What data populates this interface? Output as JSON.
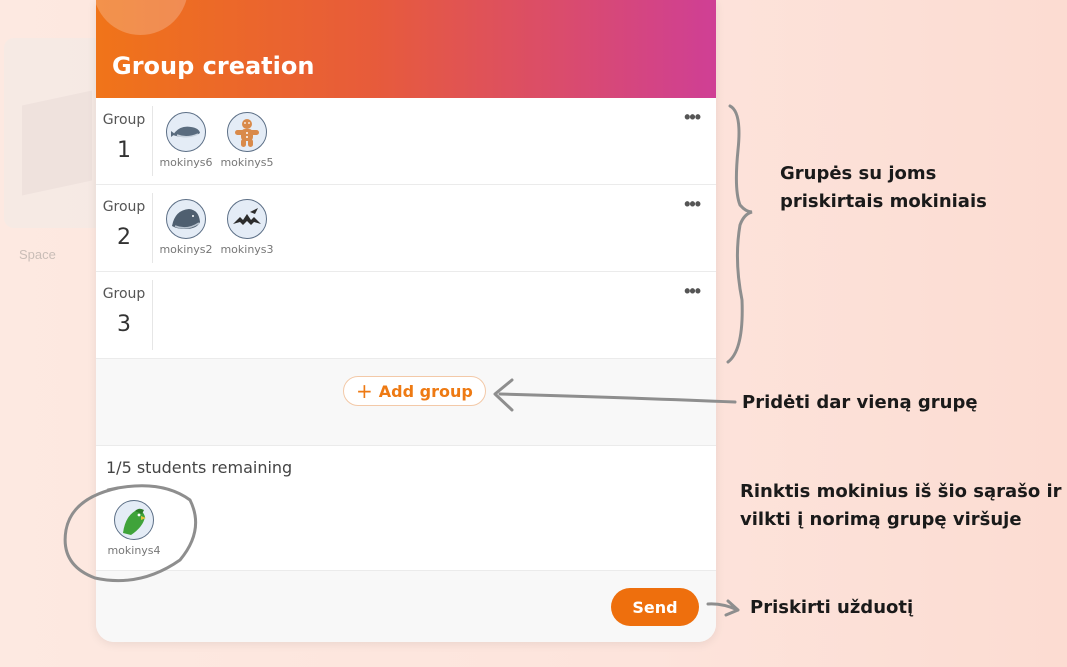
{
  "background": {
    "card_label": "Space"
  },
  "panel": {
    "title": "Group creation",
    "groups": [
      {
        "word": "Group",
        "number": "1",
        "members": [
          {
            "name": "mokinys6",
            "icon": "whale-icon"
          },
          {
            "name": "mokinys5",
            "icon": "gingerbread-icon"
          }
        ]
      },
      {
        "word": "Group",
        "number": "2",
        "members": [
          {
            "name": "mokinys2",
            "icon": "whale-icon"
          },
          {
            "name": "mokinys3",
            "icon": "bat-icon"
          }
        ]
      },
      {
        "word": "Group",
        "number": "3",
        "members": []
      }
    ],
    "more_glyph": "•••",
    "add_group_label": "Add group",
    "add_group_icon": "+",
    "remaining_text": "1/5 students remaining",
    "unassigned": [
      {
        "name": "mokinys4",
        "icon": "parrot-icon"
      }
    ],
    "send_label": "Send"
  },
  "annotations": {
    "groups_note_line1": "Grupės su joms",
    "groups_note_line2": "priskirtais mokiniais",
    "add_note": "Pridėti dar vieną grupę",
    "pick_note_line1": "Rinktis mokinius iš šio sąrašo ir",
    "pick_note_line2": "vilkti į norimą grupę viršuje",
    "send_note": "Priskirti užduotį"
  },
  "colors": {
    "accent": "#ee6f0d",
    "header_start": "#f07419",
    "header_end": "#cf3f95"
  }
}
